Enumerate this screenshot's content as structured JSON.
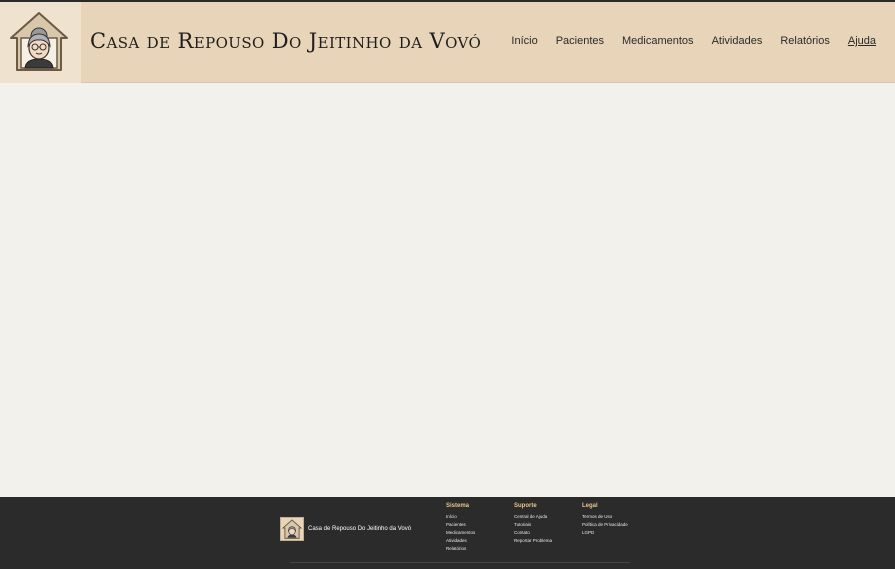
{
  "header": {
    "title": "Casa de Repouso Do Jeitinho da Vovó",
    "logo_icon": "grandma-house-icon"
  },
  "nav": {
    "items": [
      {
        "label": "Início"
      },
      {
        "label": "Pacientes"
      },
      {
        "label": "Medicamentos"
      },
      {
        "label": "Atividades"
      },
      {
        "label": "Relatórios"
      },
      {
        "label": "Ajuda"
      }
    ],
    "active": "Ajuda"
  },
  "footer": {
    "brand_name": "Casa de Repouso Do Jeitinho da Vovó",
    "columns": [
      {
        "title": "Sistema",
        "links": [
          "Início",
          "Pacientes",
          "Medicamentos",
          "Atividades",
          "Relatórios"
        ]
      },
      {
        "title": "Suporte",
        "links": [
          "Central de Ajuda",
          "Tutoriais",
          "Contato",
          "Reportar Problema"
        ]
      },
      {
        "title": "Legal",
        "links": [
          "Termos de Uso",
          "Política de Privacidade",
          "LGPD"
        ]
      }
    ]
  },
  "colors": {
    "header_bg": "#e8d5b9",
    "page_bg": "#f3f1ec",
    "footer_bg": "#2b2b2b",
    "footer_heading": "#e6c58a"
  }
}
